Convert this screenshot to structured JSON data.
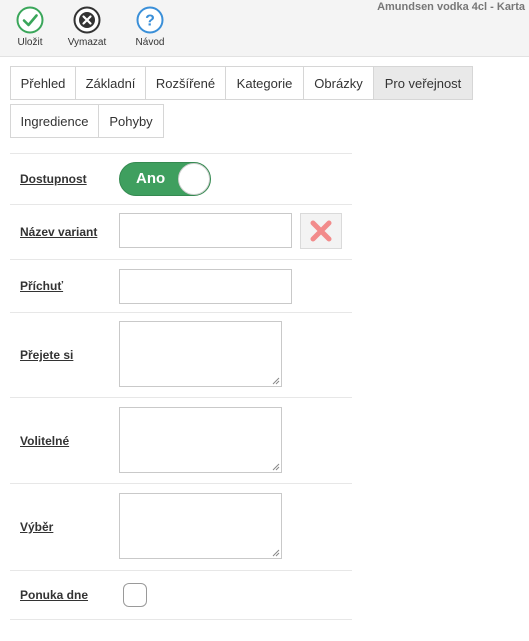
{
  "window_title": "Amundsen vodka 4cl - Karta",
  "toolbar": {
    "save_label": "Uložit",
    "delete_label": "Vymazat",
    "help_label": "Návod"
  },
  "tabs": [
    {
      "label": "Přehled",
      "active": false
    },
    {
      "label": "Základní",
      "active": false
    },
    {
      "label": "Rozšířené",
      "active": false
    },
    {
      "label": "Kategorie",
      "active": false
    },
    {
      "label": "Obrázky",
      "active": false
    },
    {
      "label": "Pro veřejnost",
      "active": true
    },
    {
      "label": "Ingredience",
      "active": false
    },
    {
      "label": "Pohyby",
      "active": false
    }
  ],
  "form": {
    "availability": {
      "label": "Dostupnost",
      "value": "Ano",
      "on": true
    },
    "variant_name": {
      "label": "Název variant",
      "value": ""
    },
    "flavor": {
      "label": "Příchuť",
      "value": ""
    },
    "wish": {
      "label": "Přejete si",
      "value": ""
    },
    "optional": {
      "label": "Volitelné",
      "value": ""
    },
    "choice": {
      "label": "Výběr",
      "value": ""
    },
    "daily_offer": {
      "label": "Ponuka dne",
      "checked": false
    }
  },
  "colors": {
    "toggle_on": "#3f9f5f",
    "save_icon": "#3aa65a",
    "delete_icon": "#333333",
    "help_icon": "#3a8fd8",
    "remove_x": "#f28b8b"
  }
}
